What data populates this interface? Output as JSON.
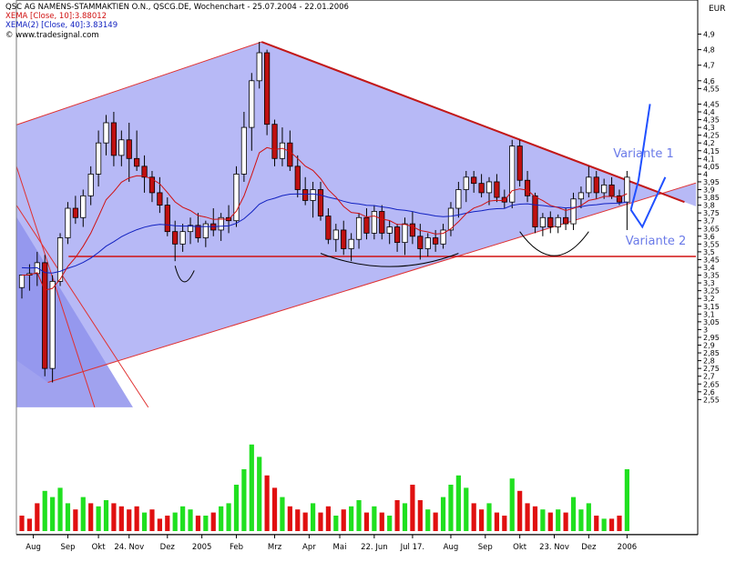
{
  "header": {
    "title": "QSC AG NAMENS-STAMMAKTIEN O.N., QSCG.DE, Wochenchart - 25.07.2004 - 22.01.2006",
    "ema1_marker": "X",
    "ema1_label": "XEMA [Close, 10]:3.88012",
    "ema2_marker": "X",
    "ema2_label": "XEMA(2) [Close, 40]:3.83149",
    "source": "www.tradesignal.com",
    "currency": "EUR"
  },
  "annotations": {
    "variante1": "Variante 1",
    "variante2": "Variante 2"
  },
  "colors": {
    "channel_fill": "#b7b9f6",
    "channel_lines": "#e03030",
    "trend_line": "#c21818",
    "support_line": "#d01010",
    "ema_fast": "#d01010",
    "ema_slow": "#1020c0",
    "candle_up": "#ffffff",
    "candle_down": "#c01010",
    "volume_up": "#20e020",
    "volume_down": "#e01010",
    "forecast": "#2050ff",
    "annotation_text": "#6a7ae8"
  },
  "chart_data": {
    "type": "candlestick",
    "xlabel": "",
    "ylabel": "EUR",
    "ylim": [
      2.5,
      5.0
    ],
    "y_ticks": [
      "4,9",
      "4,8",
      "4,7",
      "4,6",
      "4,55",
      "4,45",
      "4,4",
      "4,35",
      "4,3",
      "4,25",
      "4,2",
      "4,15",
      "4,1",
      "4,05",
      "4",
      "3,95",
      "3,9",
      "3,85",
      "3,8",
      "3,75",
      "3,7",
      "3,65",
      "3,6",
      "3,55",
      "3,5",
      "3,45",
      "3,4",
      "3,35",
      "3,3",
      "3,25",
      "3,2",
      "3,15",
      "3,1",
      "3,05",
      "3",
      "2,95",
      "2,9",
      "2,85",
      "2,8",
      "2,75",
      "2,7",
      "2,65",
      "2,6",
      "2,55"
    ],
    "x_ticks": [
      "Aug",
      "Sep",
      "Okt",
      "24. Nov",
      "Dez",
      "2005",
      "Feb",
      "Mrz",
      "Apr",
      "Mai",
      "22. Jun",
      "Jul 17.",
      "Aug",
      "Sep",
      "Okt",
      "23. Nov",
      "Dez",
      "2006"
    ],
    "x_tick_weeks": [
      1.5,
      6,
      10,
      14,
      19,
      23.5,
      28,
      33,
      37.5,
      41.5,
      46,
      51,
      56,
      60.5,
      65,
      69.5,
      74,
      79
    ],
    "candles": [
      {
        "o": 3.27,
        "h": 3.35,
        "l": 3.2,
        "c": 3.35
      },
      {
        "o": 3.35,
        "h": 3.42,
        "l": 3.25,
        "c": 3.36
      },
      {
        "o": 3.36,
        "h": 3.5,
        "l": 3.28,
        "c": 3.43
      },
      {
        "o": 3.43,
        "h": 3.48,
        "l": 2.7,
        "c": 2.75
      },
      {
        "o": 2.75,
        "h": 3.35,
        "l": 2.66,
        "c": 3.31
      },
      {
        "o": 3.31,
        "h": 3.62,
        "l": 3.28,
        "c": 3.59
      },
      {
        "o": 3.59,
        "h": 3.82,
        "l": 3.55,
        "c": 3.78
      },
      {
        "o": 3.78,
        "h": 3.86,
        "l": 3.68,
        "c": 3.72
      },
      {
        "o": 3.72,
        "h": 3.9,
        "l": 3.66,
        "c": 3.86
      },
      {
        "o": 3.86,
        "h": 4.05,
        "l": 3.8,
        "c": 4.0
      },
      {
        "o": 4.0,
        "h": 4.28,
        "l": 3.92,
        "c": 4.2
      },
      {
        "o": 4.2,
        "h": 4.38,
        "l": 4.12,
        "c": 4.33
      },
      {
        "o": 4.33,
        "h": 4.4,
        "l": 4.05,
        "c": 4.12
      },
      {
        "o": 4.12,
        "h": 4.28,
        "l": 4.05,
        "c": 4.22
      },
      {
        "o": 4.22,
        "h": 4.33,
        "l": 3.95,
        "c": 4.1
      },
      {
        "o": 4.1,
        "h": 4.28,
        "l": 4.02,
        "c": 4.05
      },
      {
        "o": 4.05,
        "h": 4.12,
        "l": 3.88,
        "c": 3.98
      },
      {
        "o": 3.98,
        "h": 4.02,
        "l": 3.82,
        "c": 3.88
      },
      {
        "o": 3.88,
        "h": 3.98,
        "l": 3.75,
        "c": 3.8
      },
      {
        "o": 3.8,
        "h": 3.85,
        "l": 3.6,
        "c": 3.63
      },
      {
        "o": 3.63,
        "h": 3.7,
        "l": 3.44,
        "c": 3.55
      },
      {
        "o": 3.55,
        "h": 3.68,
        "l": 3.5,
        "c": 3.63
      },
      {
        "o": 3.63,
        "h": 3.72,
        "l": 3.55,
        "c": 3.67
      },
      {
        "o": 3.67,
        "h": 3.75,
        "l": 3.56,
        "c": 3.59
      },
      {
        "o": 3.59,
        "h": 3.7,
        "l": 3.53,
        "c": 3.68
      },
      {
        "o": 3.68,
        "h": 3.78,
        "l": 3.6,
        "c": 3.64
      },
      {
        "o": 3.64,
        "h": 3.75,
        "l": 3.57,
        "c": 3.72
      },
      {
        "o": 3.72,
        "h": 3.8,
        "l": 3.62,
        "c": 3.7
      },
      {
        "o": 3.7,
        "h": 4.05,
        "l": 3.66,
        "c": 4.0
      },
      {
        "o": 4.0,
        "h": 4.4,
        "l": 3.95,
        "c": 4.3
      },
      {
        "o": 4.3,
        "h": 4.65,
        "l": 4.15,
        "c": 4.6
      },
      {
        "o": 4.6,
        "h": 4.85,
        "l": 4.55,
        "c": 4.78
      },
      {
        "o": 4.78,
        "h": 4.8,
        "l": 4.25,
        "c": 4.32
      },
      {
        "o": 4.32,
        "h": 4.35,
        "l": 4.05,
        "c": 4.1
      },
      {
        "o": 4.1,
        "h": 4.3,
        "l": 4.05,
        "c": 4.2
      },
      {
        "o": 4.2,
        "h": 4.28,
        "l": 4.02,
        "c": 4.05
      },
      {
        "o": 4.05,
        "h": 4.12,
        "l": 3.85,
        "c": 3.9
      },
      {
        "o": 3.9,
        "h": 3.98,
        "l": 3.8,
        "c": 3.83
      },
      {
        "o": 3.83,
        "h": 3.95,
        "l": 3.72,
        "c": 3.9
      },
      {
        "o": 3.9,
        "h": 3.95,
        "l": 3.7,
        "c": 3.73
      },
      {
        "o": 3.73,
        "h": 3.78,
        "l": 3.55,
        "c": 3.58
      },
      {
        "o": 3.58,
        "h": 3.68,
        "l": 3.5,
        "c": 3.64
      },
      {
        "o": 3.64,
        "h": 3.7,
        "l": 3.48,
        "c": 3.52
      },
      {
        "o": 3.52,
        "h": 3.62,
        "l": 3.44,
        "c": 3.58
      },
      {
        "o": 3.58,
        "h": 3.75,
        "l": 3.52,
        "c": 3.72
      },
      {
        "o": 3.72,
        "h": 3.78,
        "l": 3.58,
        "c": 3.62
      },
      {
        "o": 3.62,
        "h": 3.8,
        "l": 3.58,
        "c": 3.76
      },
      {
        "o": 3.76,
        "h": 3.8,
        "l": 3.58,
        "c": 3.62
      },
      {
        "o": 3.62,
        "h": 3.7,
        "l": 3.55,
        "c": 3.66
      },
      {
        "o": 3.66,
        "h": 3.68,
        "l": 3.5,
        "c": 3.56
      },
      {
        "o": 3.56,
        "h": 3.72,
        "l": 3.48,
        "c": 3.68
      },
      {
        "o": 3.68,
        "h": 3.76,
        "l": 3.55,
        "c": 3.6
      },
      {
        "o": 3.6,
        "h": 3.68,
        "l": 3.45,
        "c": 3.52
      },
      {
        "o": 3.52,
        "h": 3.62,
        "l": 3.47,
        "c": 3.59
      },
      {
        "o": 3.59,
        "h": 3.64,
        "l": 3.5,
        "c": 3.55
      },
      {
        "o": 3.55,
        "h": 3.68,
        "l": 3.52,
        "c": 3.64
      },
      {
        "o": 3.64,
        "h": 3.82,
        "l": 3.6,
        "c": 3.78
      },
      {
        "o": 3.78,
        "h": 3.95,
        "l": 3.72,
        "c": 3.9
      },
      {
        "o": 3.9,
        "h": 4.02,
        "l": 3.82,
        "c": 3.98
      },
      {
        "o": 3.98,
        "h": 4.02,
        "l": 3.88,
        "c": 3.94
      },
      {
        "o": 3.94,
        "h": 4.0,
        "l": 3.85,
        "c": 3.88
      },
      {
        "o": 3.88,
        "h": 3.98,
        "l": 3.8,
        "c": 3.95
      },
      {
        "o": 3.95,
        "h": 4.0,
        "l": 3.82,
        "c": 3.85
      },
      {
        "o": 3.85,
        "h": 3.9,
        "l": 3.78,
        "c": 3.82
      },
      {
        "o": 3.82,
        "h": 4.22,
        "l": 3.78,
        "c": 4.18
      },
      {
        "o": 4.18,
        "h": 4.22,
        "l": 3.92,
        "c": 3.96
      },
      {
        "o": 3.96,
        "h": 4.02,
        "l": 3.82,
        "c": 3.86
      },
      {
        "o": 3.86,
        "h": 3.88,
        "l": 3.62,
        "c": 3.66
      },
      {
        "o": 3.66,
        "h": 3.75,
        "l": 3.6,
        "c": 3.72
      },
      {
        "o": 3.72,
        "h": 3.76,
        "l": 3.62,
        "c": 3.66
      },
      {
        "o": 3.66,
        "h": 3.74,
        "l": 3.62,
        "c": 3.72
      },
      {
        "o": 3.72,
        "h": 3.78,
        "l": 3.64,
        "c": 3.68
      },
      {
        "o": 3.68,
        "h": 3.88,
        "l": 3.64,
        "c": 3.84
      },
      {
        "o": 3.84,
        "h": 3.92,
        "l": 3.78,
        "c": 3.88
      },
      {
        "o": 3.88,
        "h": 4.05,
        "l": 3.85,
        "c": 3.98
      },
      {
        "o": 3.98,
        "h": 4.02,
        "l": 3.84,
        "c": 3.88
      },
      {
        "o": 3.88,
        "h": 3.97,
        "l": 3.84,
        "c": 3.93
      },
      {
        "o": 3.93,
        "h": 3.98,
        "l": 3.84,
        "c": 3.86
      },
      {
        "o": 3.86,
        "h": 3.9,
        "l": 3.8,
        "c": 3.82
      },
      {
        "o": 3.82,
        "h": 4.02,
        "l": 3.64,
        "c": 3.98
      }
    ],
    "volume": [
      {
        "v": 5,
        "up": false
      },
      {
        "v": 4,
        "up": false
      },
      {
        "v": 9,
        "up": false
      },
      {
        "v": 13,
        "up": true
      },
      {
        "v": 11,
        "up": true
      },
      {
        "v": 14,
        "up": true
      },
      {
        "v": 9,
        "up": true
      },
      {
        "v": 7,
        "up": false
      },
      {
        "v": 11,
        "up": true
      },
      {
        "v": 9,
        "up": false
      },
      {
        "v": 8,
        "up": true
      },
      {
        "v": 10,
        "up": true
      },
      {
        "v": 9,
        "up": false
      },
      {
        "v": 8,
        "up": false
      },
      {
        "v": 7,
        "up": false
      },
      {
        "v": 8,
        "up": false
      },
      {
        "v": 6,
        "up": true
      },
      {
        "v": 7,
        "up": false
      },
      {
        "v": 4,
        "up": false
      },
      {
        "v": 5,
        "up": false
      },
      {
        "v": 6,
        "up": true
      },
      {
        "v": 8,
        "up": true
      },
      {
        "v": 7,
        "up": true
      },
      {
        "v": 5,
        "up": false
      },
      {
        "v": 5,
        "up": true
      },
      {
        "v": 6,
        "up": false
      },
      {
        "v": 8,
        "up": true
      },
      {
        "v": 9,
        "up": true
      },
      {
        "v": 15,
        "up": true
      },
      {
        "v": 20,
        "up": true
      },
      {
        "v": 28,
        "up": true
      },
      {
        "v": 24,
        "up": true
      },
      {
        "v": 18,
        "up": false
      },
      {
        "v": 14,
        "up": false
      },
      {
        "v": 11,
        "up": true
      },
      {
        "v": 8,
        "up": false
      },
      {
        "v": 7,
        "up": false
      },
      {
        "v": 6,
        "up": false
      },
      {
        "v": 9,
        "up": true
      },
      {
        "v": 6,
        "up": false
      },
      {
        "v": 8,
        "up": false
      },
      {
        "v": 5,
        "up": true
      },
      {
        "v": 7,
        "up": false
      },
      {
        "v": 8,
        "up": true
      },
      {
        "v": 10,
        "up": true
      },
      {
        "v": 6,
        "up": false
      },
      {
        "v": 8,
        "up": true
      },
      {
        "v": 6,
        "up": false
      },
      {
        "v": 5,
        "up": true
      },
      {
        "v": 10,
        "up": false
      },
      {
        "v": 9,
        "up": true
      },
      {
        "v": 15,
        "up": false
      },
      {
        "v": 10,
        "up": false
      },
      {
        "v": 7,
        "up": true
      },
      {
        "v": 6,
        "up": false
      },
      {
        "v": 11,
        "up": true
      },
      {
        "v": 15,
        "up": true
      },
      {
        "v": 18,
        "up": true
      },
      {
        "v": 14,
        "up": true
      },
      {
        "v": 9,
        "up": false
      },
      {
        "v": 7,
        "up": false
      },
      {
        "v": 9,
        "up": true
      },
      {
        "v": 6,
        "up": false
      },
      {
        "v": 5,
        "up": false
      },
      {
        "v": 17,
        "up": true
      },
      {
        "v": 13,
        "up": false
      },
      {
        "v": 9,
        "up": false
      },
      {
        "v": 8,
        "up": false
      },
      {
        "v": 7,
        "up": true
      },
      {
        "v": 6,
        "up": false
      },
      {
        "v": 7,
        "up": true
      },
      {
        "v": 6,
        "up": false
      },
      {
        "v": 11,
        "up": true
      },
      {
        "v": 7,
        "up": true
      },
      {
        "v": 9,
        "up": true
      },
      {
        "v": 5,
        "up": false
      },
      {
        "v": 4,
        "up": true
      },
      {
        "v": 4,
        "up": false
      },
      {
        "v": 5,
        "up": false
      },
      {
        "v": 20,
        "up": true
      }
    ],
    "ema_fast_label": "EMA [Close, 10]",
    "ema_slow_label": "EMA(2) [Close, 40]",
    "ema_fast_last": 3.88012,
    "ema_slow_last": 3.83149,
    "support_level": 3.47,
    "trend_line": {
      "start": {
        "week": 31.3,
        "price": 4.85
      },
      "end": {
        "week": 86.5,
        "price": 3.82
      }
    },
    "upper_channel": {
      "start": {
        "week": -3.5,
        "price": 4.27
      },
      "end": {
        "week": 31.3,
        "price": 4.85
      }
    },
    "lower_channel": {
      "start": {
        "week": 3.4,
        "price": 2.66
      },
      "end": {
        "week": 86.5,
        "price": 3.92
      }
    },
    "forecast_up": [
      {
        "week": 79.5,
        "price": 3.77
      },
      {
        "week": 80.5,
        "price": 3.96
      },
      {
        "week": 82,
        "price": 4.45
      }
    ],
    "forecast_down": [
      {
        "week": 79.5,
        "price": 3.77
      },
      {
        "week": 81,
        "price": 3.66
      },
      {
        "week": 84,
        "price": 3.98
      }
    ]
  }
}
